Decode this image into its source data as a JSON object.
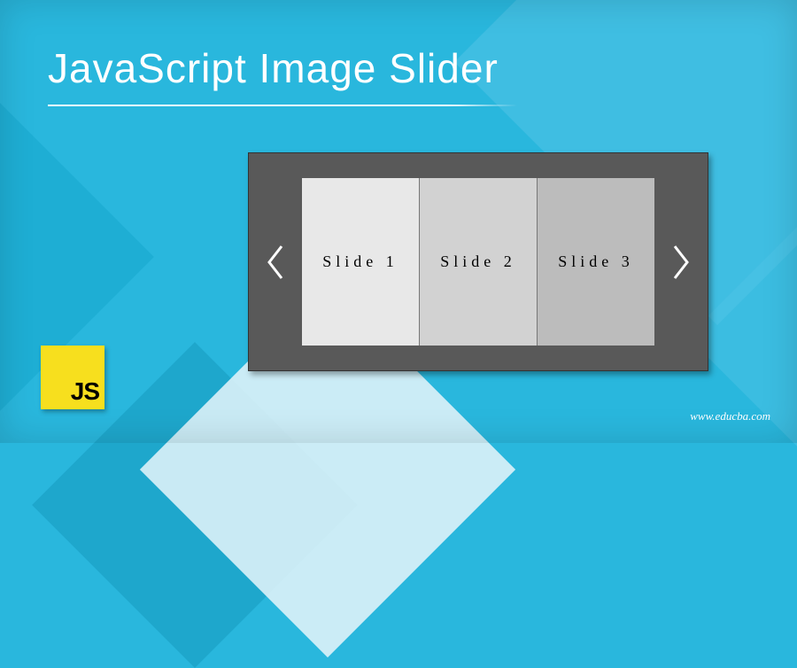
{
  "title": "JavaScript Image Slider",
  "slider": {
    "slides": [
      {
        "label": "Slide 1"
      },
      {
        "label": "Slide 2"
      },
      {
        "label": "Slide 3"
      }
    ]
  },
  "logo": {
    "text": "JS"
  },
  "site_url": "www.educba.com",
  "colors": {
    "background": "#29b7dd",
    "js_yellow": "#f7df1e",
    "slider_bg": "#595959"
  }
}
